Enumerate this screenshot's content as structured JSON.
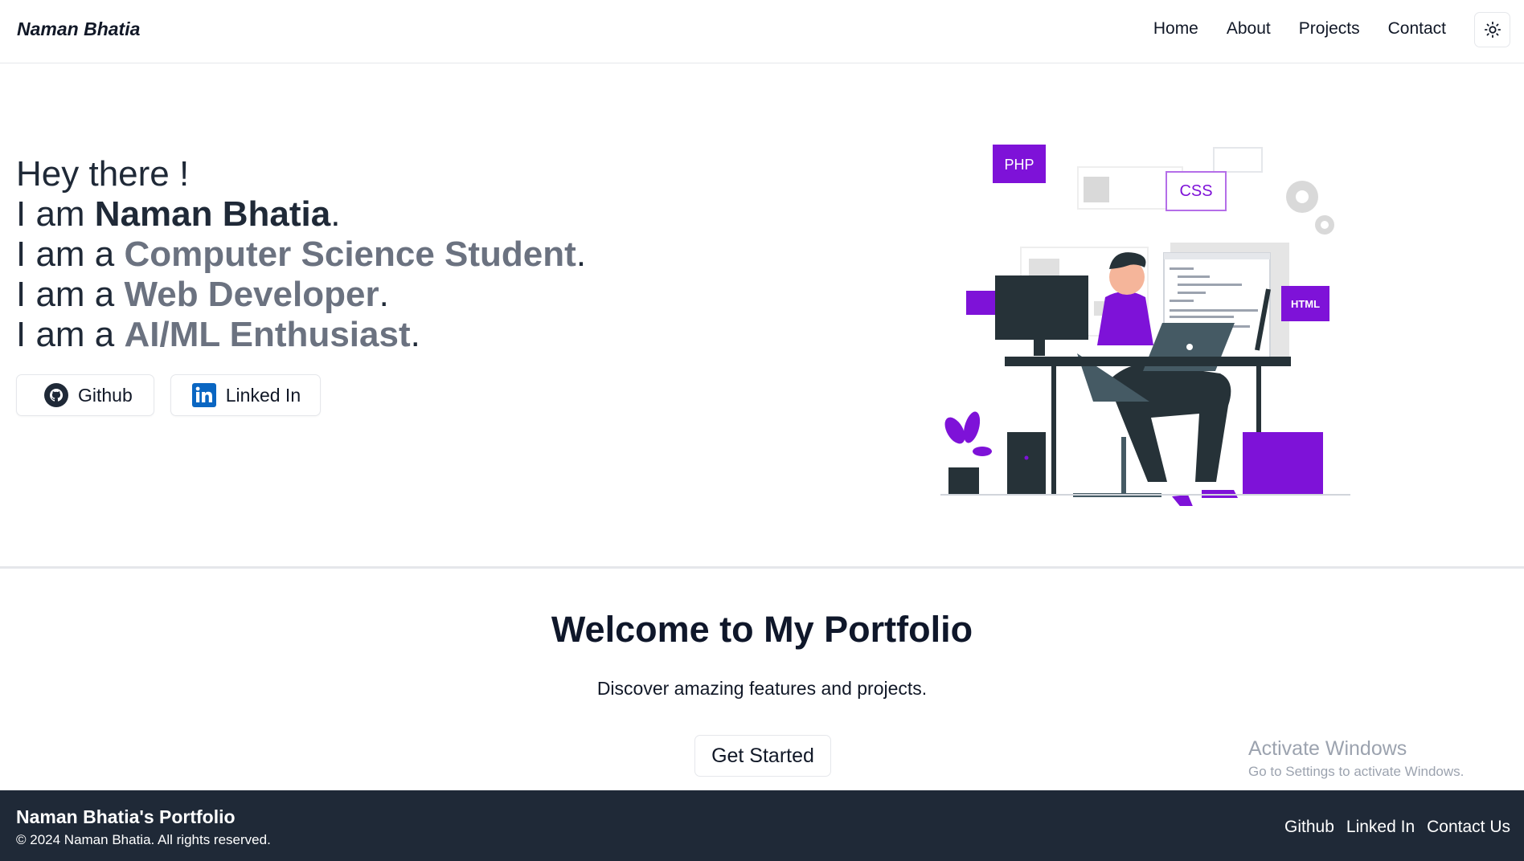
{
  "header": {
    "brand": "Naman Bhatia",
    "nav": [
      "Home",
      "About",
      "Projects",
      "Contact"
    ],
    "theme_icon": "sun-icon"
  },
  "hero": {
    "greeting": "Hey there !",
    "line_prefix_am": "I am ",
    "name": "Naman Bhatia",
    "line_prefix_ama": "I am a ",
    "roles": [
      "Computer Science Student",
      "Web Developer",
      "AI/ML Enthusiast"
    ],
    "period": ".",
    "buttons": {
      "github": "Github",
      "linkedin": "Linked In"
    },
    "illustration_labels": {
      "php": "PHP",
      "css": "CSS",
      "html": "HTML"
    }
  },
  "welcome": {
    "title": "Welcome to My Portfolio",
    "subtitle": "Discover amazing features and projects.",
    "cta": "Get Started"
  },
  "watermark": {
    "line1": "Activate Windows",
    "line2": "Go to Settings to activate Windows."
  },
  "footer": {
    "title": "Naman Bhatia's Portfolio",
    "copyright": "© 2024 Naman Bhatia. All rights reserved.",
    "links": [
      "Github",
      "Linked In",
      "Contact Us"
    ]
  },
  "colors": {
    "accent_purple": "#7e12d8",
    "footer_bg": "#1f2937",
    "role_gray": "#6b7280"
  }
}
